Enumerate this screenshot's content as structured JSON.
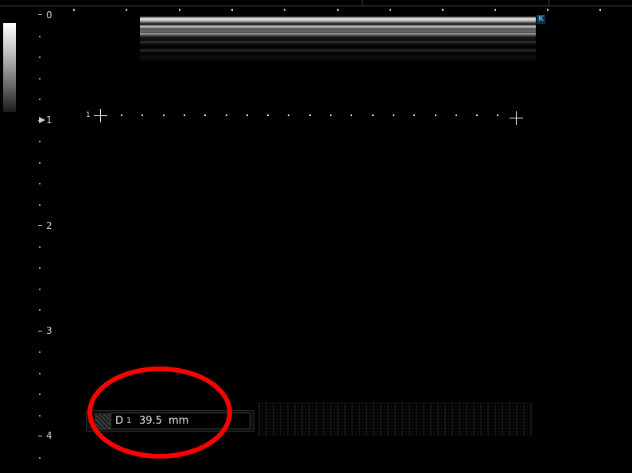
{
  "depth_scale": {
    "labels": [
      "0",
      "1",
      "2",
      "3",
      "4"
    ],
    "unit_hint": "cm"
  },
  "image": {
    "marker_label": "K"
  },
  "caliper": {
    "index": "1"
  },
  "measurement": {
    "label": "D",
    "index": "1",
    "value": "39.5",
    "unit": "mm"
  },
  "colors": {
    "background": "#000000",
    "annotation": "#ff0000",
    "marker_accent": "#5aa8e0"
  }
}
